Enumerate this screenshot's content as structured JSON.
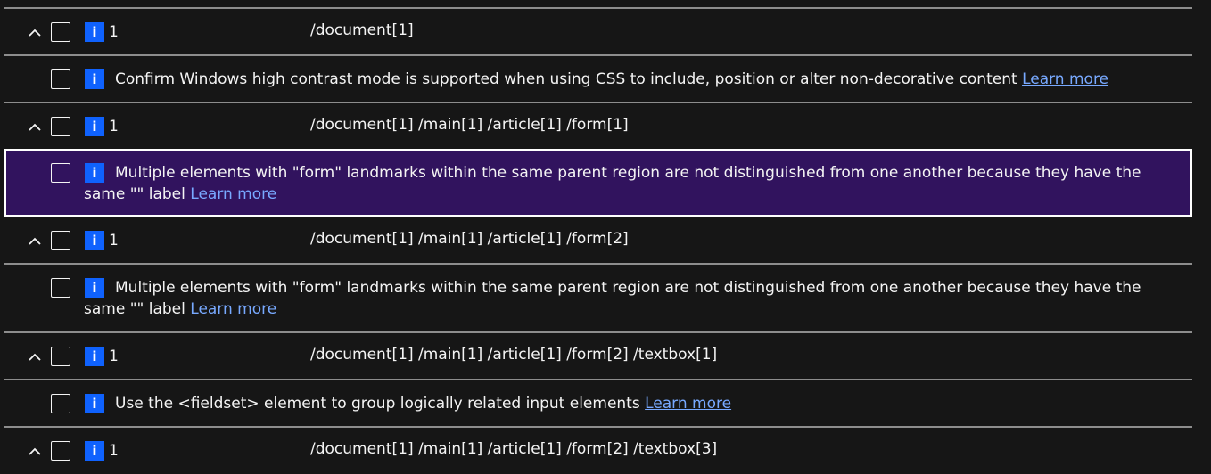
{
  "groups": [
    {
      "count": "1",
      "path": "/document[1]",
      "issue": "Confirm Windows high contrast mode is supported when using CSS to include, position or alter non-decorative content",
      "learn": "Learn more"
    },
    {
      "count": "1",
      "path": "/document[1] /main[1] /article[1] /form[1]",
      "issue": "Multiple elements with \"form\" landmarks within the same parent region are not distinguished from one another because they have the same \"\" label",
      "learn": "Learn more",
      "selected": true
    },
    {
      "count": "1",
      "path": "/document[1] /main[1] /article[1] /form[2]",
      "issue": "Multiple elements with \"form\" landmarks within the same parent region are not distinguished from one another because they have the same \"\" label",
      "learn": "Learn more"
    },
    {
      "count": "1",
      "path": "/document[1] /main[1] /article[1] /form[2] /textbox[1]",
      "issue": "Use the <fieldset> element to group logically related input elements",
      "learn": "Learn more"
    },
    {
      "count": "1",
      "path": "/document[1] /main[1] /article[1] /form[2] /textbox[3]"
    }
  ],
  "icons": {
    "info": "i",
    "chevron": "chevron-up-icon"
  },
  "colors": {
    "info_bg": "#0f62fe",
    "selected_bg": "#31135e",
    "link": "#78a9ff",
    "background": "#161616"
  }
}
